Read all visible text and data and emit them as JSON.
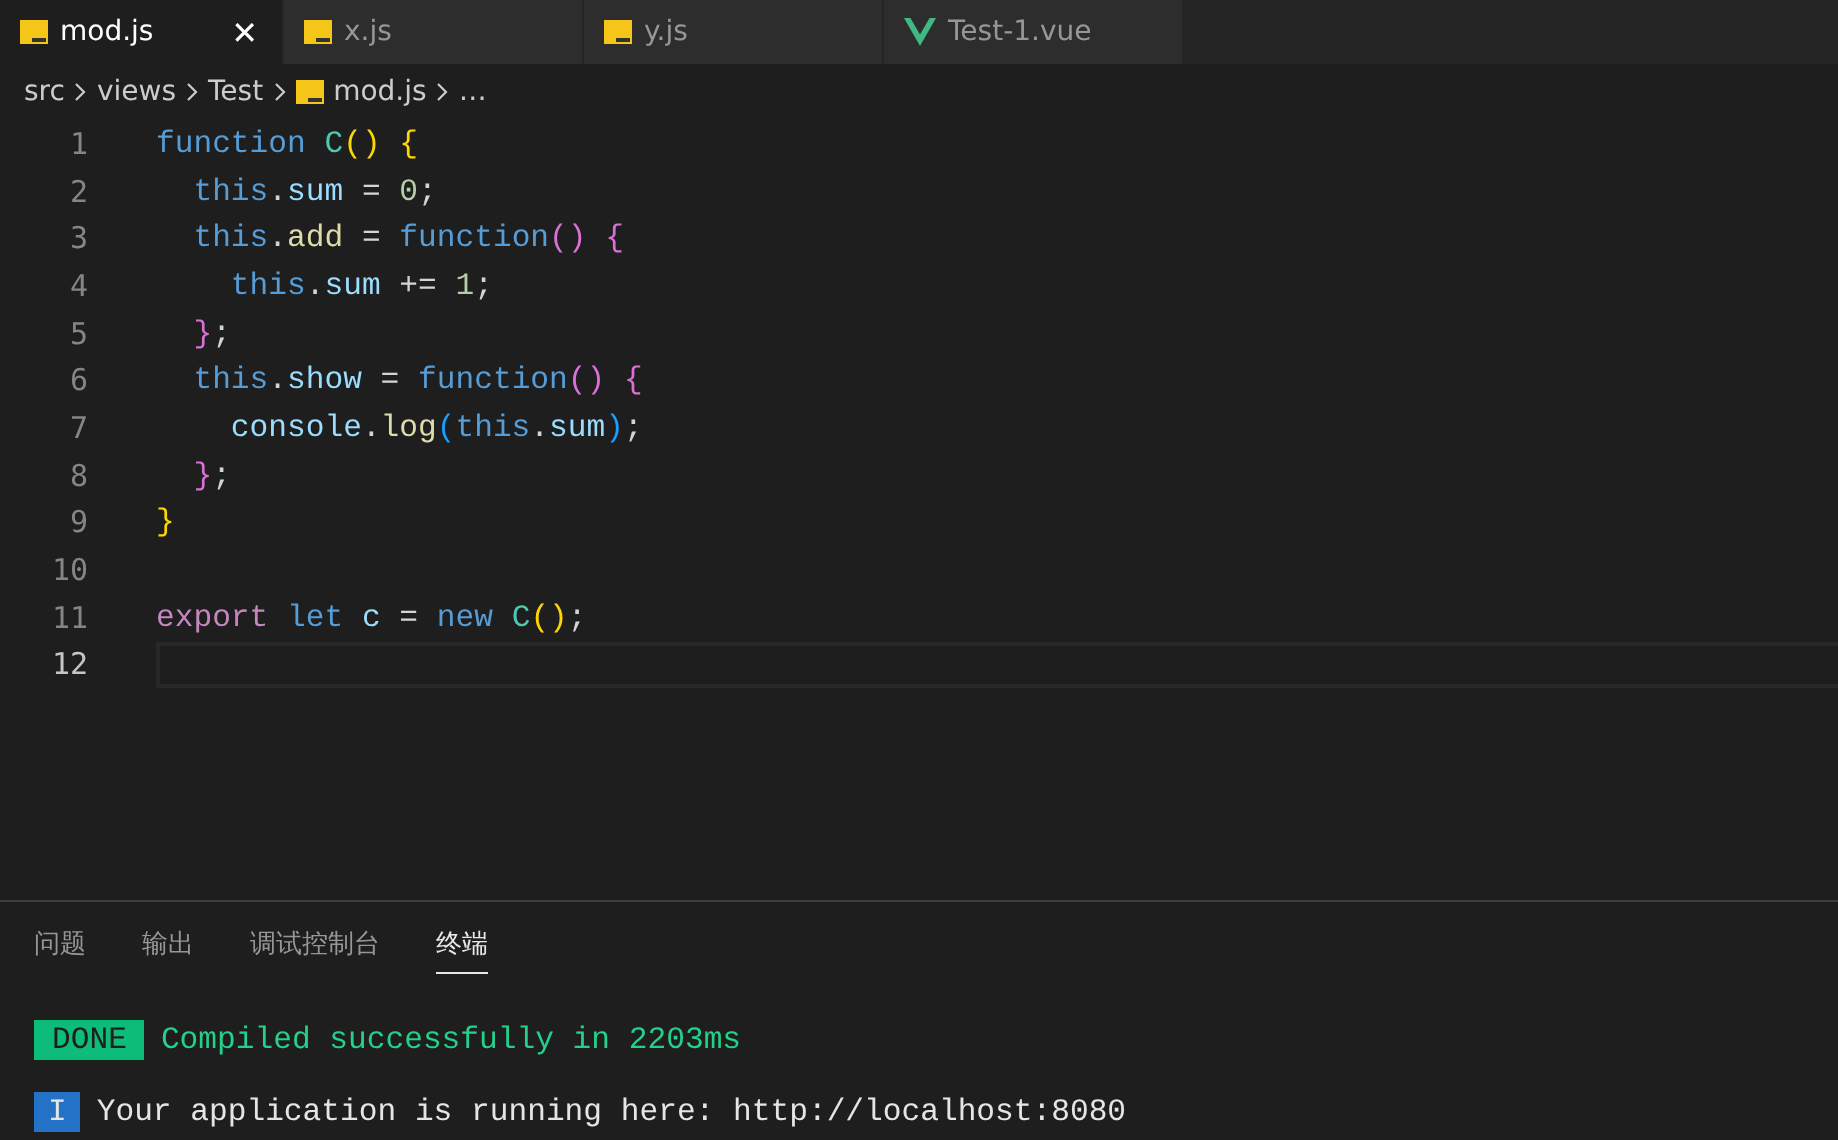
{
  "tabs": [
    {
      "kind": "script",
      "label": "mod.js",
      "selected": true,
      "close": "✕"
    },
    {
      "kind": "script",
      "label": "x.js",
      "selected": false
    },
    {
      "kind": "script",
      "label": "y.js",
      "selected": false
    },
    {
      "kind": "component",
      "label": "Test-1.vue",
      "selected": false
    }
  ],
  "breadcrumb": [
    {
      "kind": "folder",
      "label": "src"
    },
    {
      "kind": "folder",
      "label": "views"
    },
    {
      "kind": "folder",
      "label": "Test"
    },
    {
      "kind": "script",
      "label": "mod.js"
    },
    {
      "kind": "folder",
      "label": "…"
    }
  ],
  "editor": {
    "lines": [
      {
        "number": "1",
        "active": false,
        "tokens": [
          {
            "text": "function ",
            "kind": "kw"
          },
          {
            "text": "C",
            "kind": "cls"
          },
          {
            "text": "()",
            "kind": "br1"
          },
          {
            "text": " {",
            "kind": "br1"
          }
        ]
      },
      {
        "number": "2",
        "active": false,
        "tokens": [
          {
            "text": "  this",
            "kind": "kw"
          },
          {
            "text": ".",
            "kind": "p"
          },
          {
            "text": "sum",
            "kind": "var"
          },
          {
            "text": " = ",
            "kind": "p"
          },
          {
            "text": "0",
            "kind": "num"
          },
          {
            "text": ";",
            "kind": "p"
          }
        ]
      },
      {
        "number": "3",
        "active": false,
        "tokens": [
          {
            "text": "  this",
            "kind": "kw"
          },
          {
            "text": ".",
            "kind": "p"
          },
          {
            "text": "add",
            "kind": "fn"
          },
          {
            "text": " = ",
            "kind": "p"
          },
          {
            "text": "function",
            "kind": "kw"
          },
          {
            "text": "()",
            "kind": "br2"
          },
          {
            "text": " {",
            "kind": "br2"
          }
        ]
      },
      {
        "number": "4",
        "active": false,
        "tokens": [
          {
            "text": "    this",
            "kind": "kw"
          },
          {
            "text": ".",
            "kind": "p"
          },
          {
            "text": "sum",
            "kind": "var"
          },
          {
            "text": " += ",
            "kind": "p"
          },
          {
            "text": "1",
            "kind": "num"
          },
          {
            "text": ";",
            "kind": "p"
          }
        ]
      },
      {
        "number": "5",
        "active": false,
        "tokens": [
          {
            "text": "  }",
            "kind": "br2"
          },
          {
            "text": ";",
            "kind": "p"
          }
        ]
      },
      {
        "number": "6",
        "active": false,
        "tokens": [
          {
            "text": "  this",
            "kind": "kw"
          },
          {
            "text": ".",
            "kind": "p"
          },
          {
            "text": "show",
            "kind": "var"
          },
          {
            "text": " = ",
            "kind": "p"
          },
          {
            "text": "function",
            "kind": "kw"
          },
          {
            "text": "()",
            "kind": "br2"
          },
          {
            "text": " {",
            "kind": "br2"
          }
        ]
      },
      {
        "number": "7",
        "active": false,
        "tokens": [
          {
            "text": "    console",
            "kind": "var"
          },
          {
            "text": ".",
            "kind": "p"
          },
          {
            "text": "log",
            "kind": "fn"
          },
          {
            "text": "(",
            "kind": "br3"
          },
          {
            "text": "this",
            "kind": "kw"
          },
          {
            "text": ".",
            "kind": "p"
          },
          {
            "text": "sum",
            "kind": "var"
          },
          {
            "text": ")",
            "kind": "br3"
          },
          {
            "text": ";",
            "kind": "p"
          }
        ]
      },
      {
        "number": "8",
        "active": false,
        "tokens": [
          {
            "text": "  }",
            "kind": "br2"
          },
          {
            "text": ";",
            "kind": "p"
          }
        ]
      },
      {
        "number": "9",
        "active": false,
        "tokens": [
          {
            "text": "}",
            "kind": "br1"
          }
        ]
      },
      {
        "number": "10",
        "active": false
      },
      {
        "number": "11",
        "active": false,
        "tokens": [
          {
            "text": "export ",
            "kind": "ctl"
          },
          {
            "text": "let ",
            "kind": "kw"
          },
          {
            "text": "c",
            "kind": "var"
          },
          {
            "text": " = ",
            "kind": "p"
          },
          {
            "text": "new ",
            "kind": "kw"
          },
          {
            "text": "C",
            "kind": "cls"
          },
          {
            "text": "()",
            "kind": "br1"
          },
          {
            "text": ";",
            "kind": "p"
          }
        ]
      },
      {
        "number": "12",
        "active": true
      }
    ]
  },
  "panel": {
    "tabs": [
      {
        "label": "问题",
        "selected": false
      },
      {
        "label": "输出",
        "selected": false
      },
      {
        "label": "调试控制台",
        "selected": false
      },
      {
        "label": "终端",
        "selected": true
      }
    ],
    "terminal": [
      {
        "kind": "done",
        "badge": "DONE",
        "text": "Compiled successfully in 2203ms"
      },
      {
        "kind": "info",
        "badge": "I",
        "text": "Your application is running here: http://localhost:8080"
      }
    ]
  }
}
